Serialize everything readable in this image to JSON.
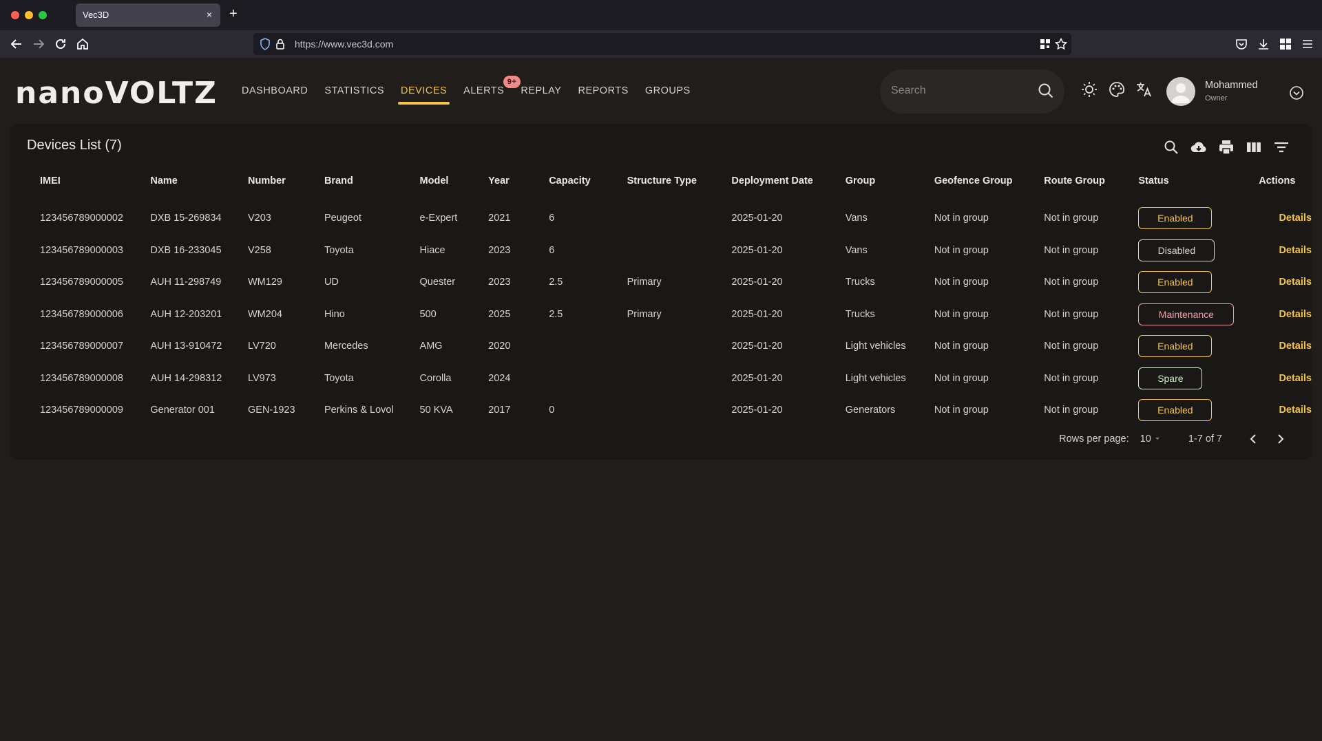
{
  "browser": {
    "tab_title": "Vec3D",
    "tab_close": "×",
    "new_tab": "+",
    "url": "https://www.vec3d.com"
  },
  "app": {
    "logo": "nanoVOLTZ",
    "nav": [
      {
        "label": "DASHBOARD"
      },
      {
        "label": "STATISTICS"
      },
      {
        "label": "DEVICES",
        "active": true
      },
      {
        "label": "ALERTS",
        "badge": "9+"
      },
      {
        "label": "REPLAY"
      },
      {
        "label": "REPORTS"
      },
      {
        "label": "GROUPS"
      }
    ],
    "search_placeholder": "Search",
    "user": {
      "name": "Mohammed",
      "role": "Owner"
    }
  },
  "devices": {
    "title": "Devices List (7)",
    "columns": [
      "IMEI",
      "Name",
      "Number",
      "Brand",
      "Model",
      "Year",
      "Capacity",
      "Structure Type",
      "Deployment Date",
      "Group",
      "Geofence Group",
      "Route Group",
      "Status",
      "Actions"
    ],
    "rows": [
      {
        "imei": "123456789000002",
        "name": "DXB 15-269834",
        "number": "V203",
        "brand": "Peugeot",
        "model": "e-Expert",
        "year": "2021",
        "capacity": "6",
        "structure": "",
        "deployed": "2025-01-20",
        "group": "Vans",
        "geofence": "Not in group",
        "route": "Not in group",
        "status": "Enabled",
        "action": "Details"
      },
      {
        "imei": "123456789000003",
        "name": "DXB 16-233045",
        "number": "V258",
        "brand": "Toyota",
        "model": "Hiace",
        "year": "2023",
        "capacity": "6",
        "structure": "",
        "deployed": "2025-01-20",
        "group": "Vans",
        "geofence": "Not in group",
        "route": "Not in group",
        "status": "Disabled",
        "action": "Details"
      },
      {
        "imei": "123456789000005",
        "name": "AUH 11-298749",
        "number": "WM129",
        "brand": "UD",
        "model": "Quester",
        "year": "2023",
        "capacity": "2.5",
        "structure": "Primary",
        "deployed": "2025-01-20",
        "group": "Trucks",
        "geofence": "Not in group",
        "route": "Not in group",
        "status": "Enabled",
        "action": "Details"
      },
      {
        "imei": "123456789000006",
        "name": "AUH 12-203201",
        "number": "WM204",
        "brand": "Hino",
        "model": "500",
        "year": "2025",
        "capacity": "2.5",
        "structure": "Primary",
        "deployed": "2025-01-20",
        "group": "Trucks",
        "geofence": "Not in group",
        "route": "Not in group",
        "status": "Maintenance",
        "action": "Details"
      },
      {
        "imei": "123456789000007",
        "name": "AUH 13-910472",
        "number": "LV720",
        "brand": "Mercedes",
        "model": "AMG",
        "year": "2020",
        "capacity": "",
        "structure": "",
        "deployed": "2025-01-20",
        "group": "Light vehicles",
        "geofence": "Not in group",
        "route": "Not in group",
        "status": "Enabled",
        "action": "Details"
      },
      {
        "imei": "123456789000008",
        "name": "AUH 14-298312",
        "number": "LV973",
        "brand": "Toyota",
        "model": "Corolla",
        "year": "2024",
        "capacity": "",
        "structure": "",
        "deployed": "2025-01-20",
        "group": "Light vehicles",
        "geofence": "Not in group",
        "route": "Not in group",
        "status": "Spare",
        "action": "Details"
      },
      {
        "imei": "123456789000009",
        "name": "Generator 001",
        "number": "GEN-1923",
        "brand": "Perkins & Lovol",
        "model": "50 KVA",
        "year": "2017",
        "capacity": "0",
        "structure": "",
        "deployed": "2025-01-20",
        "group": "Generators",
        "geofence": "Not in group",
        "route": "Not in group",
        "status": "Enabled",
        "action": "Details"
      }
    ],
    "pagination": {
      "rows_label": "Rows per page:",
      "rows_value": "10",
      "range": "1-7 of 7"
    }
  },
  "colors": {
    "accent": "#f4c54a",
    "background": "#201d1a",
    "card": "#1a1816",
    "status_enabled": "#f4c54a",
    "status_disabled": "#dad4cf",
    "status_maintenance": "#f0a0a4",
    "status_spare": "#cfe8c9",
    "badge": "#f08a88"
  },
  "icons": [
    "back-arrow-icon",
    "forward-arrow-icon",
    "reload-icon",
    "home-icon",
    "shield-icon",
    "lock-icon",
    "qr-grid-icon",
    "star-icon",
    "pocket-icon",
    "download-icon",
    "extensions-icon",
    "menu-icon",
    "search-icon",
    "brightness-icon",
    "palette-icon",
    "translate-icon",
    "avatar-icon",
    "chevron-down-icon",
    "cloud-download-icon",
    "print-icon",
    "columns-icon",
    "filter-icon",
    "chevron-left-icon",
    "chevron-right-icon"
  ]
}
